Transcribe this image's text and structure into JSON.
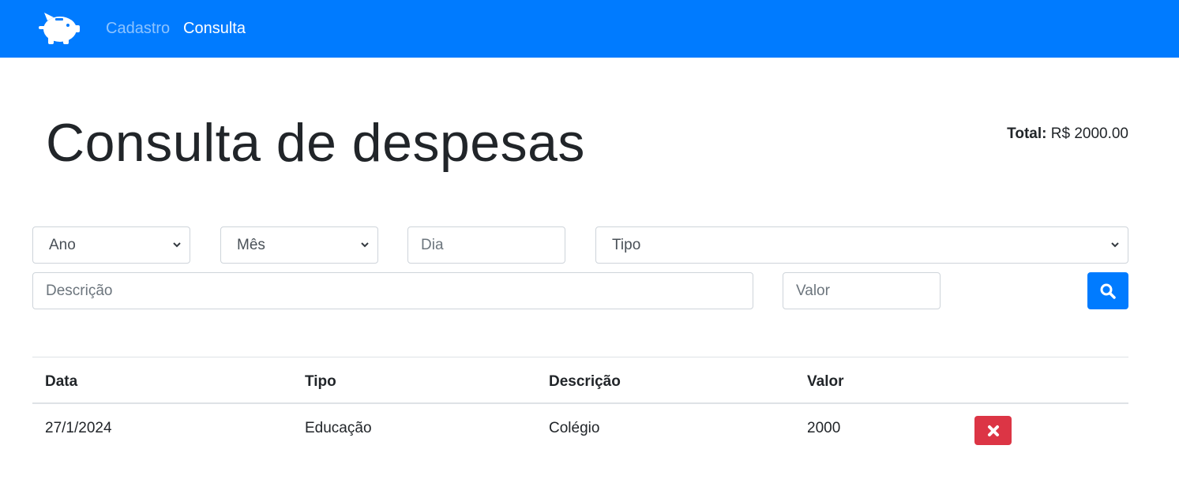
{
  "navbar": {
    "logo_icon": "piggy-bank-icon",
    "links": [
      {
        "label": "Cadastro",
        "active": false
      },
      {
        "label": "Consulta",
        "active": true
      }
    ],
    "background": "#007bff"
  },
  "header": {
    "title": "Consulta de despesas",
    "total_label": "Total:",
    "total_value": "R$ 2000.00"
  },
  "filters": {
    "ano": {
      "selected": "Ano"
    },
    "mes": {
      "selected": "Mês"
    },
    "dia": {
      "placeholder": "Dia"
    },
    "tipo": {
      "selected": "Tipo"
    },
    "descricao": {
      "placeholder": "Descrição"
    },
    "valor": {
      "placeholder": "Valor"
    },
    "search_icon": "search-icon"
  },
  "table": {
    "columns": [
      "Data",
      "Tipo",
      "Descrição",
      "Valor"
    ],
    "rows": [
      {
        "data": "27/1/2024",
        "tipo": "Educação",
        "descricao": "Colégio",
        "valor": "2000",
        "action_icon": "close-icon"
      }
    ]
  },
  "colors": {
    "primary": "#007bff",
    "danger": "#dc3545"
  }
}
